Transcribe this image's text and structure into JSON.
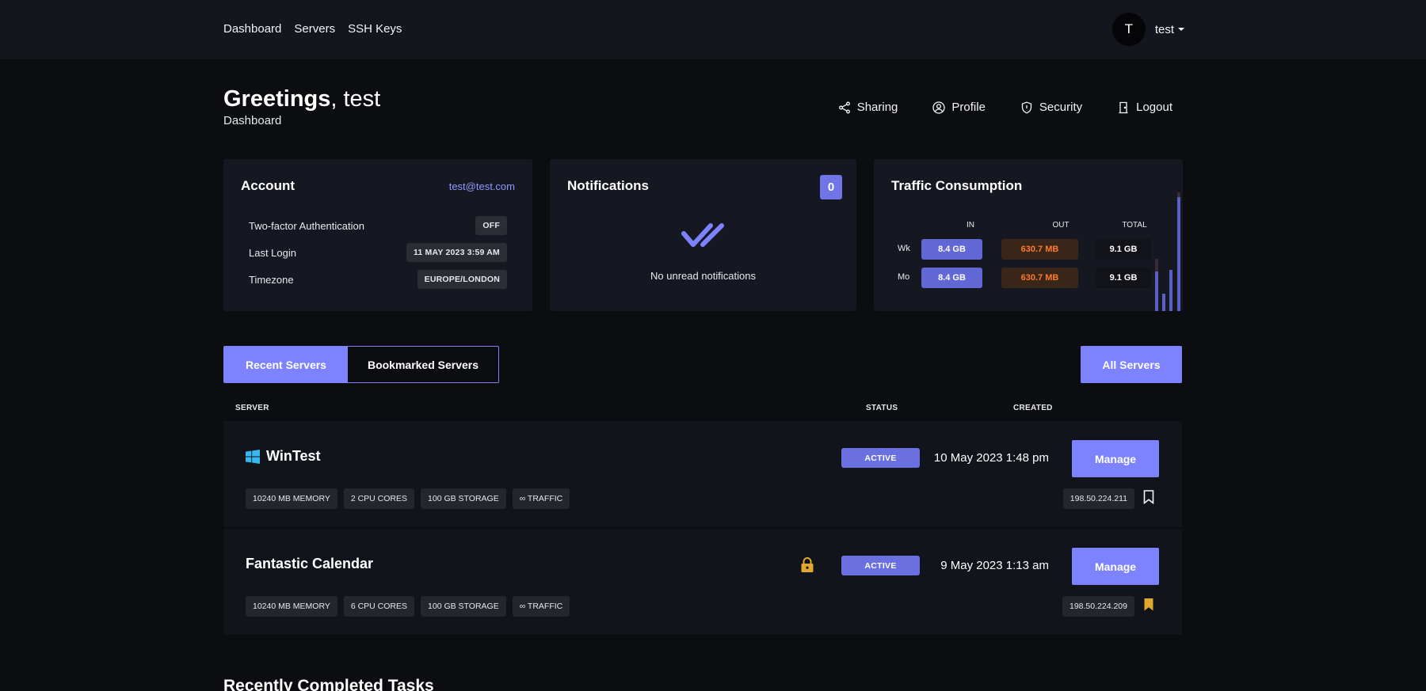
{
  "nav": {
    "items": [
      "Dashboard",
      "Servers",
      "SSH Keys"
    ]
  },
  "user": {
    "initial": "T",
    "name": "test"
  },
  "header": {
    "greeting": "Greetings",
    "greeting_rest": ", test",
    "subtitle": "Dashboard"
  },
  "actions": {
    "sharing": "Sharing",
    "profile": "Profile",
    "security": "Security",
    "logout": "Logout"
  },
  "account": {
    "title": "Account",
    "email": "test@test.com",
    "rows": [
      {
        "label": "Two-factor Authentication",
        "value": "OFF"
      },
      {
        "label": "Last Login",
        "value": "11 MAY 2023 3:59 AM"
      },
      {
        "label": "Timezone",
        "value": "EUROPE/LONDON"
      }
    ]
  },
  "notifications": {
    "title": "Notifications",
    "count": "0",
    "message": "No unread notifications"
  },
  "traffic": {
    "title": "Traffic Consumption",
    "headers": {
      "in": "IN",
      "out": "OUT",
      "total": "TOTAL"
    },
    "week": {
      "label": "Wk",
      "in": "8.4 GB",
      "out": "630.7 MB",
      "total": "9.1 GB"
    },
    "month": {
      "label": "Mo",
      "in": "8.4 GB",
      "out": "630.7 MB",
      "total": "9.1 GB"
    },
    "colors": {
      "in": "#6167d4",
      "out": "#ff7a29"
    }
  },
  "tabs": {
    "recent": "Recent Servers",
    "bookmarked": "Bookmarked Servers",
    "all_button": "All Servers"
  },
  "table": {
    "col_server": "SERVER",
    "col_status": "STATUS",
    "col_created": "CREATED"
  },
  "servers": [
    {
      "name": "WinTest",
      "os_icon": "windows-icon",
      "status": "ACTIVE",
      "created": "10 May 2023 1:48 pm",
      "manage": "Manage",
      "specs": [
        "10240 MB MEMORY",
        "2 CPU CORES",
        "100 GB STORAGE",
        "∞ TRAFFIC"
      ],
      "ip": "198.50.224.211",
      "bookmarked": false
    },
    {
      "name": "Fantastic Calendar",
      "status": "ACTIVE",
      "created": "9 May 2023 1:13 am",
      "manage": "Manage",
      "specs": [
        "10240 MB MEMORY",
        "6 CPU CORES",
        "100 GB STORAGE",
        "∞ TRAFFIC"
      ],
      "ip": "198.50.224.209",
      "bookmarked": true,
      "locked": true
    }
  ],
  "tasks": {
    "title": "Recently Completed Tasks"
  },
  "colors": {
    "accent": "#7d83ff",
    "bookmark": "#e0a82e"
  }
}
